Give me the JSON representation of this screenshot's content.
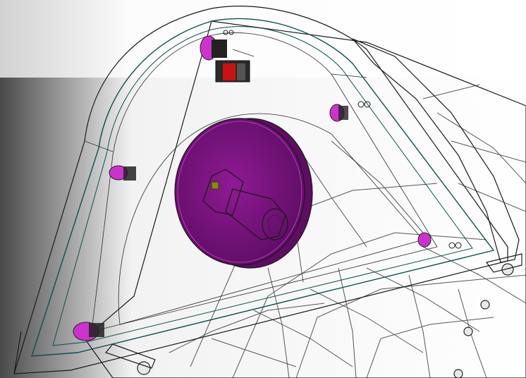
{
  "scene": {
    "kind": "cad-3d-render",
    "colors": {
      "background_light": "#ffffff",
      "background_shadow": "#3a3a3a",
      "housing_shell": "#d9d9d9",
      "housing_band": "#cc1111",
      "cover_glass": "#1e9a98",
      "cover_interior": "#5a2a2a",
      "disc": "#7a1480",
      "disc_rim": "#9b20a3",
      "motor": "#e6e600",
      "mount_clips": "#cc33cc",
      "center_bracket": "#2a2a2a"
    },
    "components": [
      "transparent-cover",
      "rotor-disc",
      "drive-motor",
      "mount-clips",
      "lattice-housing",
      "red-seal-band"
    ]
  }
}
